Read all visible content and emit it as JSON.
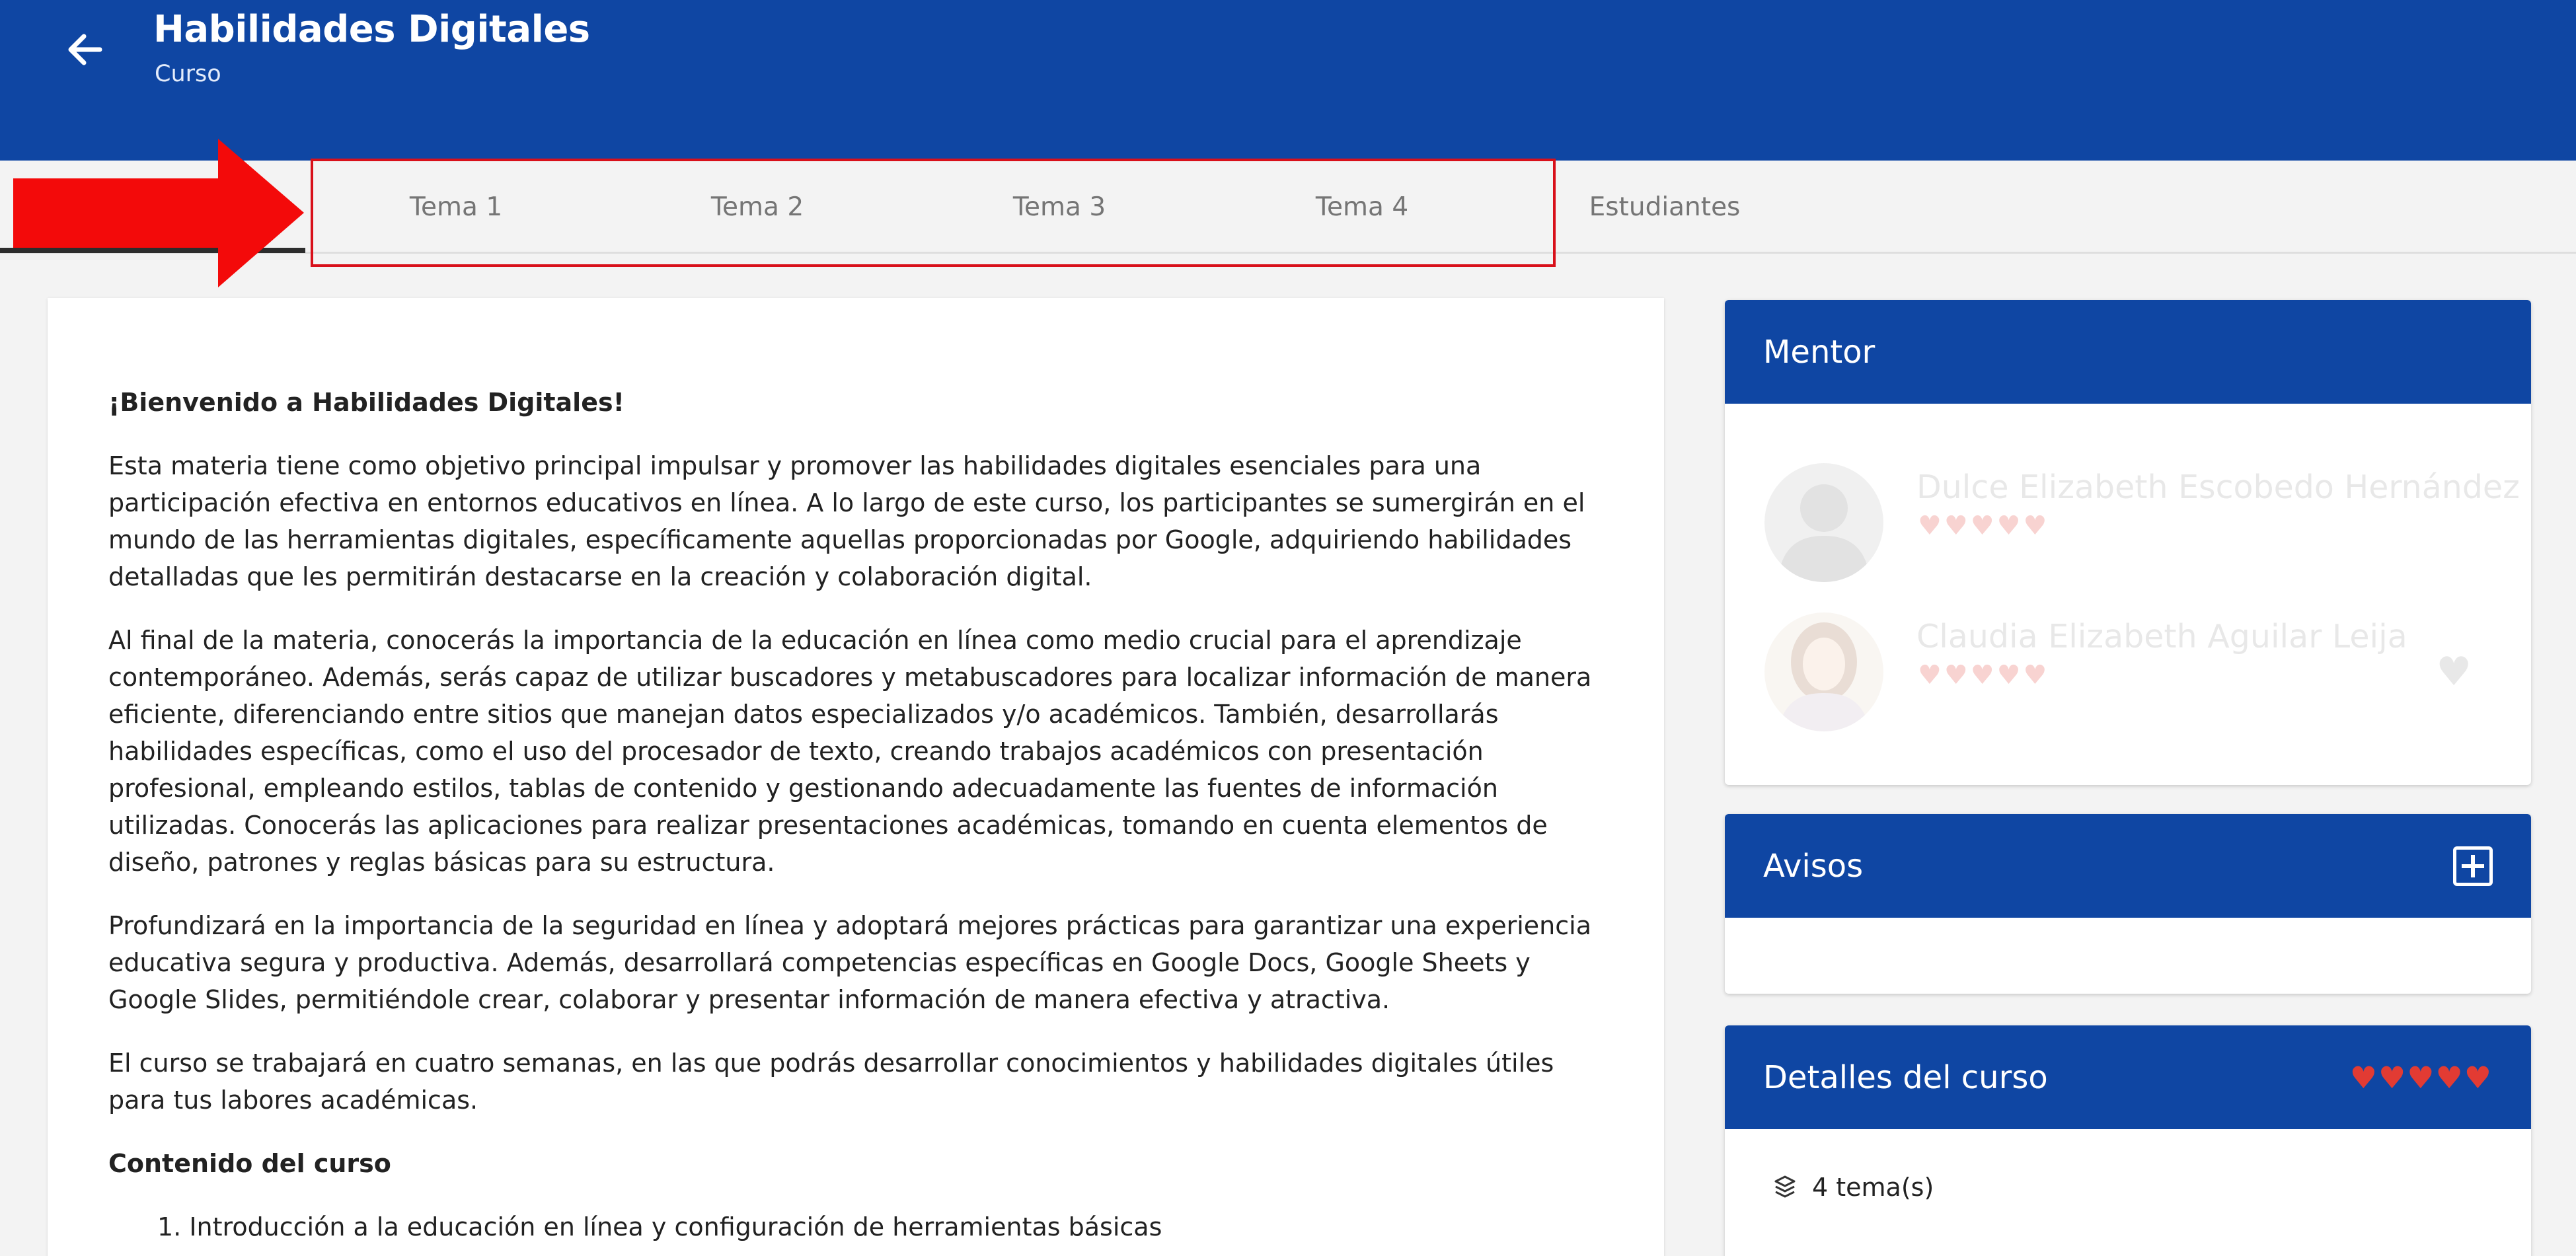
{
  "header": {
    "title": "Habilidades Digitales",
    "subtitle": "Curso"
  },
  "tabs": [
    {
      "label": "Tema 1"
    },
    {
      "label": "Tema 2"
    },
    {
      "label": "Tema 3"
    },
    {
      "label": "Tema 4"
    },
    {
      "label": "Estudiantes"
    }
  ],
  "content": {
    "heading": "¡Bienvenido a Habilidades Digitales!",
    "paragraphs": [
      "Esta materia tiene como objetivo principal impulsar y promover las habilidades digitales esenciales para una participación efectiva en entornos educativos en línea. A lo largo de este curso, los participantes se sumergirán en el mundo de las herramientas digitales, específicamente aquellas proporcionadas por Google, adquiriendo habilidades detalladas que les permitirán destacarse en la creación y colaboración digital.",
      "Al final de la materia, conocerás la importancia de la educación en línea como medio crucial para el aprendizaje contemporáneo. Además, serás capaz de utilizar buscadores y metabuscadores para localizar información de manera eficiente, diferenciando entre sitios que manejan datos especializados y/o académicos. También, desarrollarás habilidades específicas, como el uso del procesador de texto, creando trabajos académicos con presentación profesional, empleando estilos, tablas de contenido y gestionando adecuadamente las fuentes de información utilizadas. Conocerás las aplicaciones para realizar presentaciones académicas, tomando en cuenta elementos de diseño, patrones y reglas básicas para su estructura.",
      "Profundizará en la importancia de la seguridad en línea y adoptará mejores prácticas para garantizar una experiencia educativa segura y productiva. Además, desarrollará competencias específicas en Google Docs, Google Sheets y Google Slides, permitiéndole crear, colaborar y presentar información de manera efectiva y atractiva.",
      "El curso se trabajará en cuatro semanas, en las que podrás desarrollar conocimientos y habilidades digitales útiles para tus labores académicas."
    ],
    "contents_heading": "Contenido del curso",
    "contents_items": [
      "1. Introducción a la educación en línea y configuración de herramientas básicas"
    ]
  },
  "mentor": {
    "title": "Mentor",
    "people": [
      {
        "name": "Dulce Elizabeth Escobedo Hernández",
        "hearts": "♥♥♥♥♥"
      },
      {
        "name": "Claudia Elizabeth Aguilar Leija",
        "hearts": "♥♥♥♥♥"
      }
    ],
    "fav_icon": "heart-icon"
  },
  "avisos": {
    "title": "Avisos",
    "add_icon": "add-box-icon"
  },
  "detalles": {
    "title": "Detalles del curso",
    "rating": {
      "value": 5,
      "max": 5,
      "hearts": "♥♥♥♥♥"
    },
    "topics_count": "4 tema(s)"
  },
  "colors": {
    "header_bg": "#0f46a3",
    "highlight": "#d8101a",
    "hearts": "#e23b33"
  }
}
